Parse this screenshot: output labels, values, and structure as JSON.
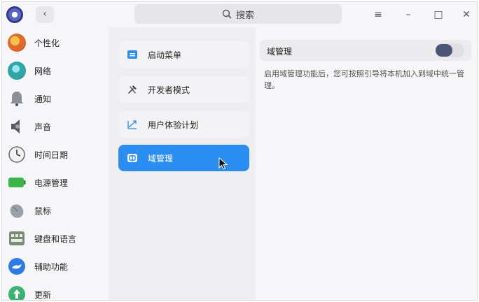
{
  "titlebar": {
    "search_text": "搜索",
    "back_glyph": "‹",
    "menu_glyph": "≡",
    "minimize_glyph": "–",
    "maximize_glyph": "□",
    "close_glyph": "✕"
  },
  "sidebar": {
    "items": [
      {
        "label": "个性化",
        "icon": "personalization-icon",
        "color": "#e06a2c"
      },
      {
        "label": "网络",
        "icon": "network-icon",
        "color": "#2fa6a8"
      },
      {
        "label": "通知",
        "icon": "notification-bell-icon",
        "color": "#8b8f96"
      },
      {
        "label": "声音",
        "icon": "speaker-icon",
        "color": "#555a63"
      },
      {
        "label": "时间日期",
        "icon": "clock-icon",
        "color": "#f2f2f2"
      },
      {
        "label": "电源管理",
        "icon": "battery-icon",
        "color": "#39b54a"
      },
      {
        "label": "鼠标",
        "icon": "mouse-icon",
        "color": "#9aa0a8"
      },
      {
        "label": "键盘和语言",
        "icon": "keyboard-icon",
        "color": "#7b8a74"
      },
      {
        "label": "辅助功能",
        "icon": "accessibility-icon",
        "color": "#2f7ae5"
      },
      {
        "label": "更新",
        "icon": "update-icon",
        "color": "#3cb371"
      }
    ]
  },
  "middle": {
    "items": [
      {
        "label": "启动菜单",
        "icon": "boot-menu-icon",
        "active": false
      },
      {
        "label": "开发者模式",
        "icon": "developer-tools-icon",
        "active": false
      },
      {
        "label": "用户体验计划",
        "icon": "user-experience-icon",
        "active": false
      },
      {
        "label": "域管理",
        "icon": "domain-management-icon",
        "active": true
      }
    ]
  },
  "right": {
    "domain_title": "域管理",
    "domain_toggle_state": "off",
    "domain_description": "启用域管理功能后，您可按照引导将本机加入到域中统一管理。"
  },
  "colors": {
    "accent": "#2b8df0",
    "toggle_knob": "#4a5673"
  }
}
